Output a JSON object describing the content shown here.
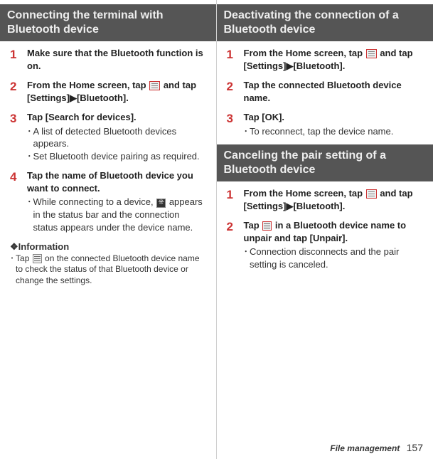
{
  "left": {
    "heading": "Connecting the terminal with Bluetooth device",
    "steps": [
      {
        "num": "1",
        "title": "Make sure that the Bluetooth function is on.",
        "bullets": []
      },
      {
        "num": "2",
        "title_a": "From the Home screen, tap ",
        "title_b": " and tap [Settings]",
        "title_c": "[Bluetooth].",
        "bullets": []
      },
      {
        "num": "3",
        "title": "Tap [Search for devices].",
        "bullets": [
          "A list of detected Bluetooth devices appears.",
          "Set Bluetooth device pairing as required."
        ]
      },
      {
        "num": "4",
        "title": "Tap the name of Bluetooth device you want to connect.",
        "bullets_a": "While connecting to a device, ",
        "bullets_b": " appears in the status bar and the connection status appears under the device name."
      }
    ],
    "info_head": "❖Information",
    "info_a": "Tap ",
    "info_b": " on the connected Bluetooth device name to check the status of that Bluetooth device or change the settings."
  },
  "right": {
    "sec1": {
      "heading": "Deactivating the connection of a Bluetooth device",
      "steps": [
        {
          "num": "1",
          "title_a": "From the Home screen, tap ",
          "title_b": " and tap [Settings]",
          "title_c": "[Bluetooth]."
        },
        {
          "num": "2",
          "title": "Tap the connected Bluetooth device name."
        },
        {
          "num": "3",
          "title": "Tap [OK].",
          "bullets": [
            "To reconnect, tap the device name."
          ]
        }
      ]
    },
    "sec2": {
      "heading": "Canceling the pair setting of a Bluetooth device",
      "steps": [
        {
          "num": "1",
          "title_a": "From the Home screen, tap ",
          "title_b": " and tap [Settings]",
          "title_c": "[Bluetooth]."
        },
        {
          "num": "2",
          "title_a": "Tap ",
          "title_b": " in a Bluetooth device name to unpair and tap [Unpair].",
          "bullets": [
            "Connection disconnects and the pair setting is canceled."
          ]
        }
      ]
    }
  },
  "footer": {
    "section": "File management",
    "page": "157"
  },
  "arrow": "▶"
}
